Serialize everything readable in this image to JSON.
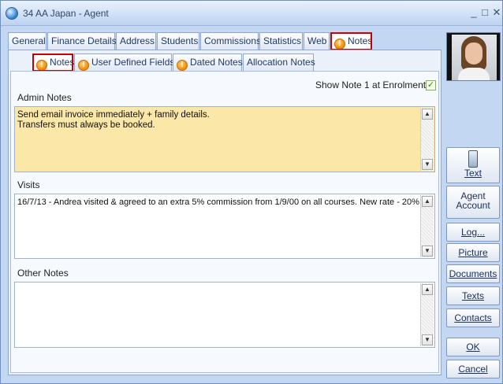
{
  "window": {
    "title": "34 AA Japan - Agent",
    "controls": {
      "minimize": "_",
      "maximize": "□",
      "close": "✕"
    }
  },
  "main_tabs": [
    {
      "label": "General"
    },
    {
      "label": "Finance Details"
    },
    {
      "label": "Address"
    },
    {
      "label": "Students"
    },
    {
      "label": "Commissions"
    },
    {
      "label": "Statistics"
    },
    {
      "label": "Web"
    },
    {
      "label": "Notes",
      "icon": "info-icon",
      "selected": true
    }
  ],
  "sub_tabs": [
    {
      "label": "Notes",
      "icon": "info-icon",
      "selected": true
    },
    {
      "label": "User Defined Fields",
      "icon": "info-icon"
    },
    {
      "label": "Dated Notes",
      "icon": "info-icon"
    },
    {
      "label": "Allocation Notes"
    }
  ],
  "notes_panel": {
    "show_note_label": "Show Note 1 at Enrolment",
    "show_note_checked": true,
    "admin_notes": {
      "label": "Admin Notes",
      "value": "Send email invoice immediately + family details.\nTransfers must always be booked."
    },
    "visits": {
      "label": "Visits",
      "value": "16/7/13 - Andrea visited & agreed to an extra 5% commission from 1/9/00 on all courses. New rate - 20%"
    },
    "other_notes": {
      "label": "Other Notes",
      "value": ""
    }
  },
  "sidebar": {
    "text_button": "Text",
    "agent_account_line1": "Agent",
    "agent_account_line2": "Account",
    "log_button": "Log...",
    "picture_button": "Picture",
    "documents_button": "Documents",
    "texts_button": "Texts",
    "contacts_button": "Contacts",
    "ok_button": "OK",
    "cancel_button": "Cancel"
  },
  "colors": {
    "window_bg": "#c3d7f2",
    "admin_notes_bg": "#fbe7a8",
    "highlight_outline": "#c40000"
  }
}
